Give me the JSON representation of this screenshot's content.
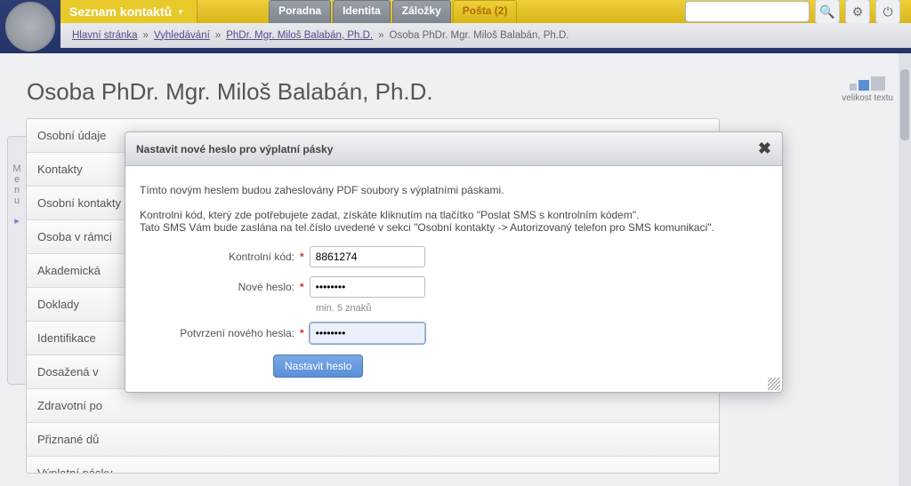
{
  "header": {
    "main_tab": "Seznam kontaktů",
    "mini_tabs": [
      {
        "label": "Poradna",
        "active": false
      },
      {
        "label": "Identita",
        "active": false
      },
      {
        "label": "Záložky",
        "active": false
      },
      {
        "label": "Pošta (2)",
        "active": true
      }
    ],
    "search_placeholder": ""
  },
  "breadcrumb": {
    "home": "Hlavní stránka",
    "sep": "»",
    "search": "Vyhledávání",
    "person_link": "PhDr. Mgr. Miloš Balabán, Ph.D.",
    "tail": "Osoba PhDr. Mgr. Miloš Balabán, Ph.D."
  },
  "textsize_label": "velikost textu",
  "page_title": "Osoba PhDr. Mgr. Miloš Balabán, Ph.D.",
  "side_handle": "Menu",
  "tabs": [
    "Osobní údaje",
    "Kontakty",
    "Osobní kontakty",
    "Osoba v rámci",
    "Akademická",
    "Doklady",
    "Identifikace",
    "Dosažená v",
    "Zdravotní po",
    "Přiznané dů",
    "Výplatní pásky"
  ],
  "dialog": {
    "title": "Nastavit nové heslo pro výplatní pásky",
    "intro": "Tímto novým heslem budou zaheslovány PDF soubory s výplatními páskami.",
    "para2a": "Kontrolní kód, který zde potřebujete zadat, získáte kliknutím na tlačítko \"Poslat SMS s kontrolním kódem\".",
    "para2b": "Tato SMS Vám bude zaslána na tel.číslo uvedené v sekci \"Osobní kontakty -> Autorizovaný telefon pro SMS komunikaci\".",
    "field_code_label": "Kontrolní kód:",
    "field_code_value": "8861274",
    "field_pass_label": "Nové heslo:",
    "field_pass_value": "••••••••",
    "field_pass_hint": "min. 5 znaků",
    "field_confirm_label": "Potvrzení nového hesla:",
    "field_confirm_value": "••••••••",
    "submit": "Nastavit heslo"
  }
}
